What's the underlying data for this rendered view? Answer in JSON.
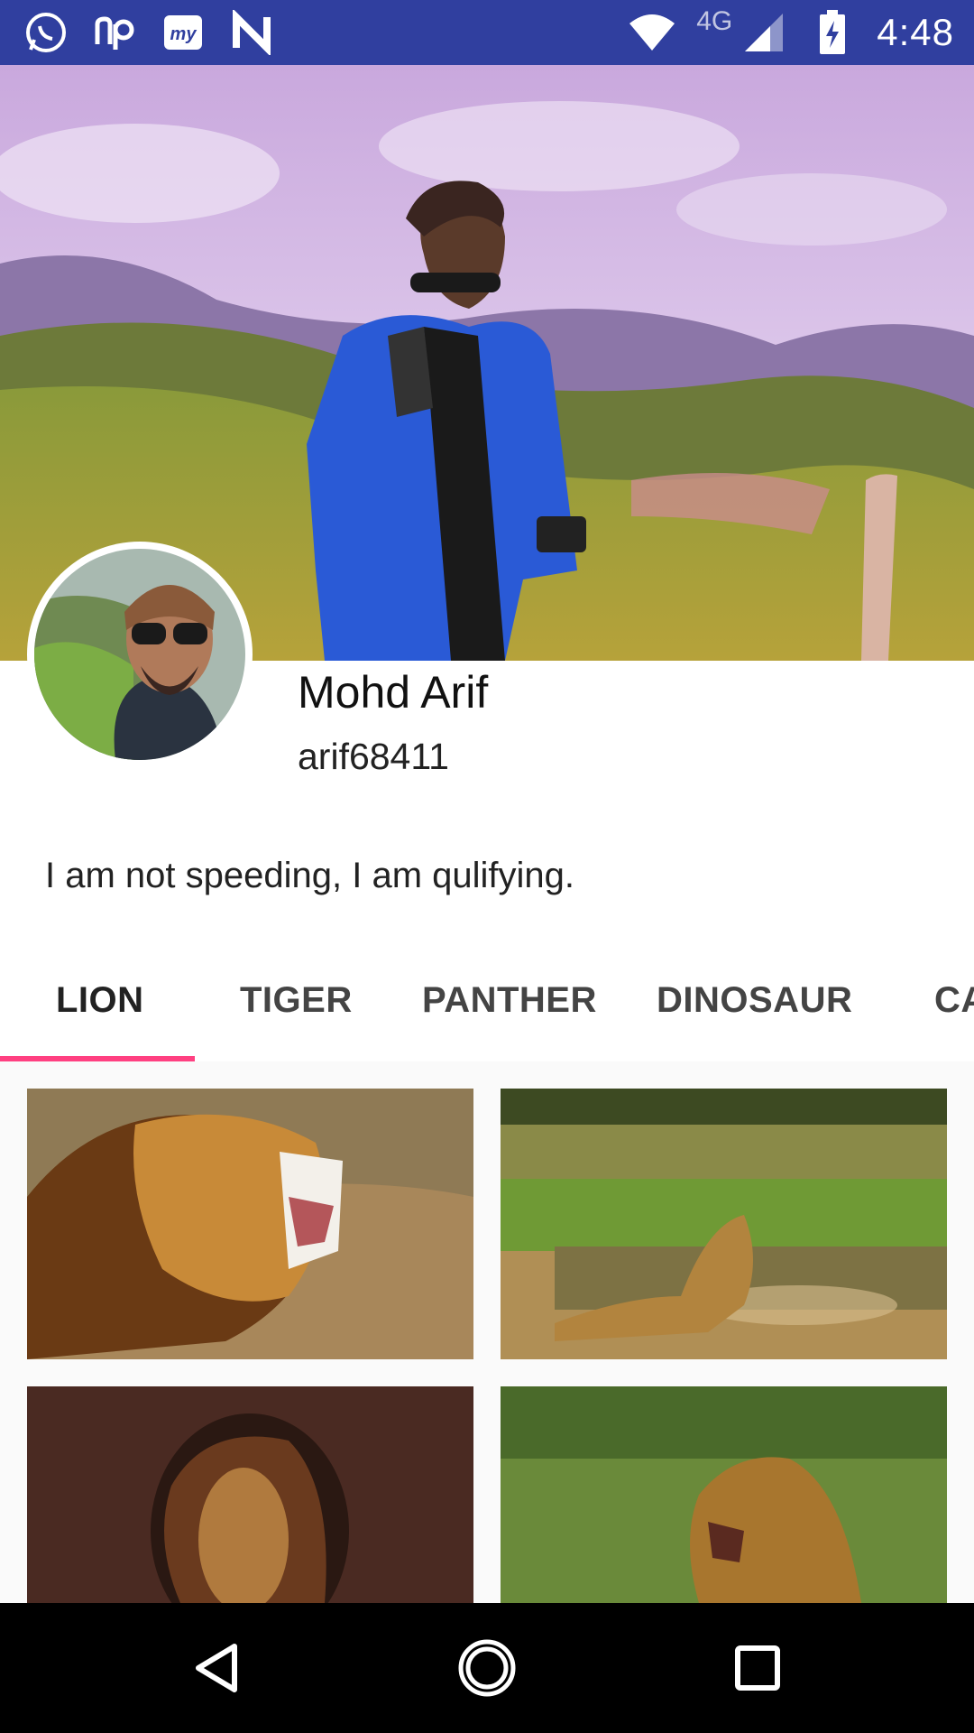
{
  "status_bar": {
    "time": "4:48",
    "network": "4G",
    "left_icons": [
      "whatsapp-icon",
      "np-icon",
      "my-app-icon",
      "n-icon"
    ],
    "right_icons": [
      "wifi-icon",
      "signal-icon",
      "battery-charging-icon"
    ],
    "bg_color": "#303f9f"
  },
  "profile": {
    "name": "Mohd Arif",
    "username": "arif68411",
    "bio": "I am not speeding, I am qulifying."
  },
  "tabs": [
    {
      "label": "LION",
      "active": true
    },
    {
      "label": "TIGER",
      "active": false
    },
    {
      "label": "PANTHER",
      "active": false
    },
    {
      "label": "DINOSAUR",
      "active": false
    },
    {
      "label": "CA",
      "active": false
    }
  ],
  "accent_color": "#ff4081",
  "gallery": {
    "tiles": [
      "lion-photo-1",
      "lion-photo-2",
      "lion-photo-3",
      "lion-photo-4"
    ]
  },
  "nav_bar": {
    "buttons": [
      "back-icon",
      "home-icon",
      "recents-icon"
    ]
  }
}
